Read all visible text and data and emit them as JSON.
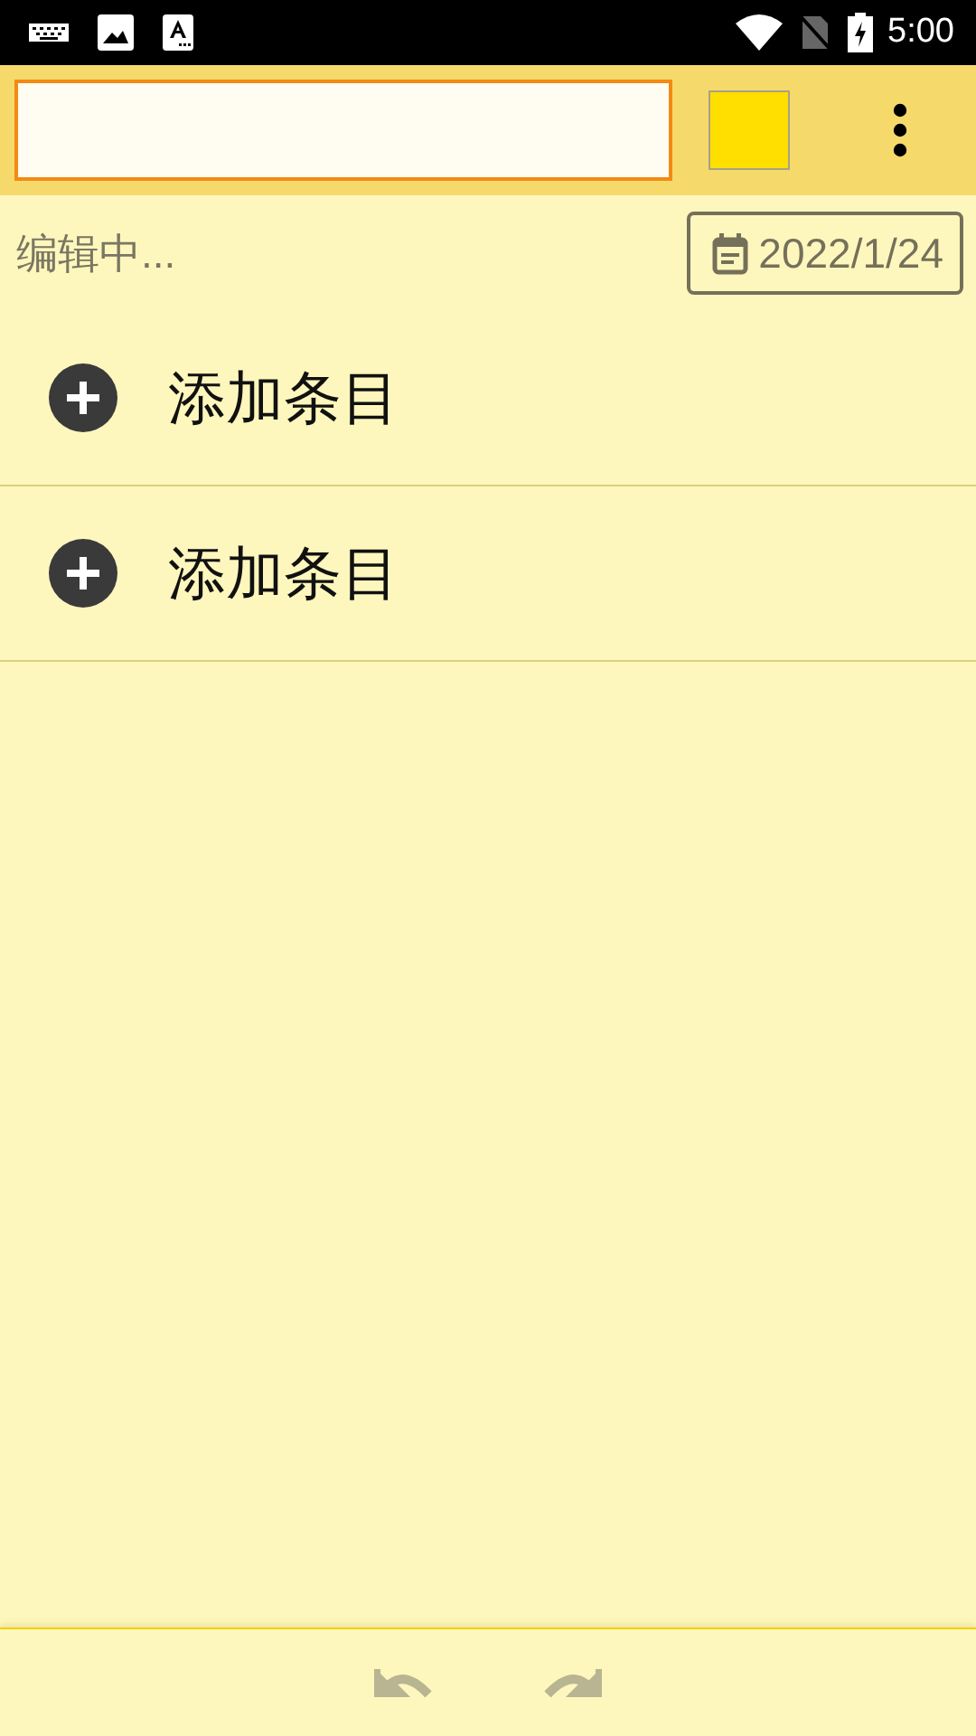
{
  "status_bar": {
    "time": "5:00"
  },
  "toolbar": {
    "color_swatch": {
      "color": "#ffdf00"
    }
  },
  "subheader": {
    "status": "编辑中...",
    "date": "2022/1/24"
  },
  "items": [
    {
      "label": "添加条目"
    },
    {
      "label": "添加条目"
    }
  ],
  "bottom_bar": {
    "undo": {
      "disabled": true
    },
    "redo": {
      "disabled": true
    }
  }
}
